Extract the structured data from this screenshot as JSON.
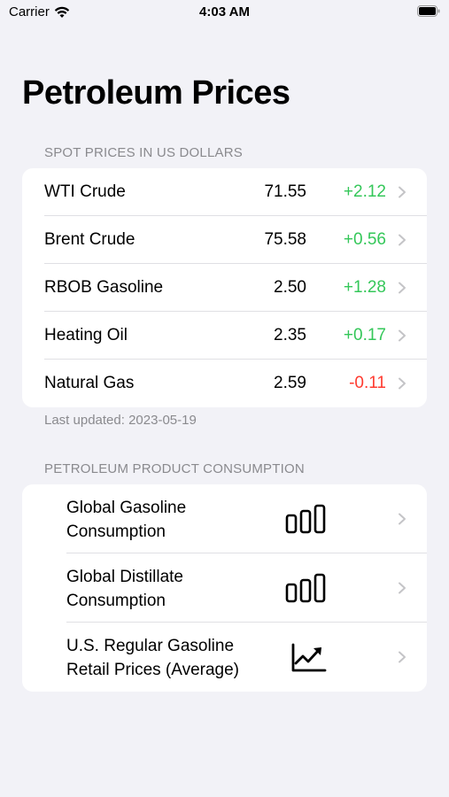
{
  "status_bar": {
    "carrier": "Carrier",
    "time": "4:03 AM"
  },
  "page": {
    "title": "Petroleum Prices"
  },
  "spot_prices": {
    "header": "SPOT PRICES IN US DOLLARS",
    "rows": [
      {
        "name": "WTI Crude",
        "price": "71.55",
        "change": "+2.12",
        "direction": "up"
      },
      {
        "name": "Brent Crude",
        "price": "75.58",
        "change": "+0.56",
        "direction": "up"
      },
      {
        "name": "RBOB Gasoline",
        "price": "2.50",
        "change": "+1.28",
        "direction": "up"
      },
      {
        "name": "Heating Oil",
        "price": "2.35",
        "change": "+0.17",
        "direction": "up"
      },
      {
        "name": "Natural Gas",
        "price": "2.59",
        "change": "-0.11",
        "direction": "down"
      }
    ],
    "last_updated": "Last updated: 2023-05-19"
  },
  "consumption": {
    "header": "PETROLEUM PRODUCT CONSUMPTION",
    "rows": [
      {
        "label": "Global Gasoline Consumption",
        "icon": "bar-chart-icon"
      },
      {
        "label": "Global Distillate Consumption",
        "icon": "bar-chart-icon"
      },
      {
        "label": "U.S. Regular Gasoline Retail Prices (Average)",
        "icon": "line-chart-icon"
      }
    ]
  },
  "colors": {
    "background": "#f2f2f7",
    "positive": "#34c759",
    "negative": "#ff3b30",
    "secondary_text": "#8a8a8e",
    "chevron": "#c4c4c7"
  }
}
